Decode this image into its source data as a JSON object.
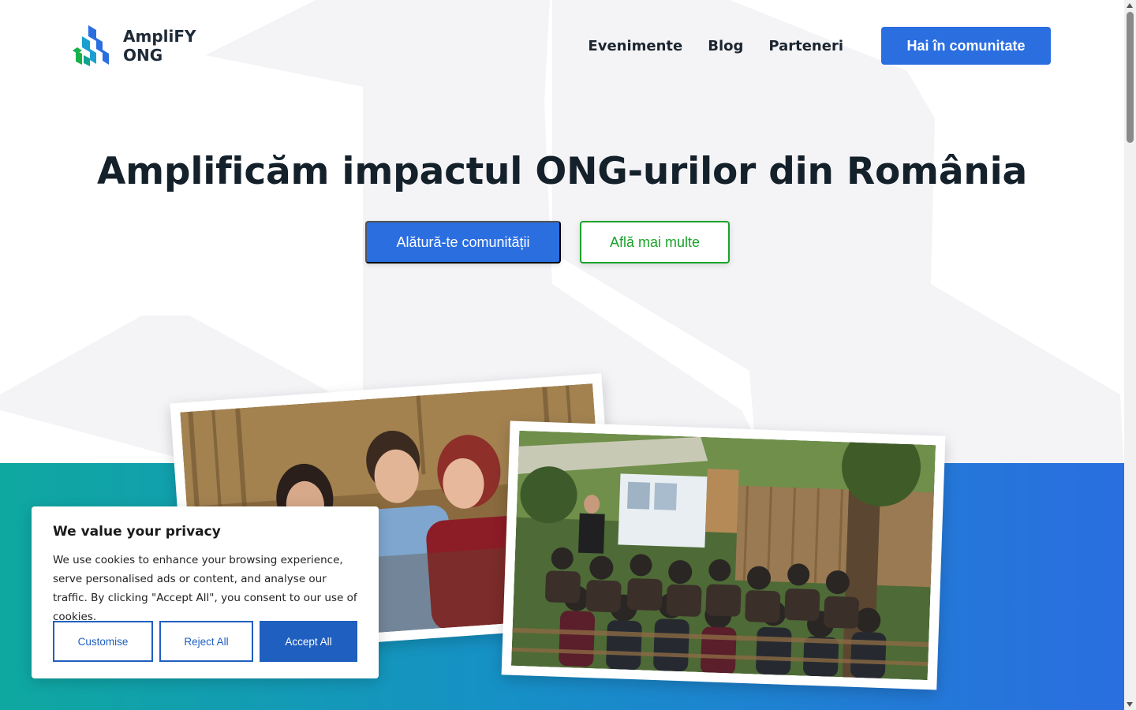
{
  "header": {
    "logo_line1": "AmpliFY",
    "logo_line2": "ONG",
    "nav": [
      {
        "label": "Evenimente"
      },
      {
        "label": "Blog"
      },
      {
        "label": "Parteneri"
      }
    ],
    "cta_label": "Hai în comunitate"
  },
  "hero": {
    "title": "Amplificăm impactul ONG-urilor din România",
    "primary_label": "Alătură-te comunității",
    "secondary_label": "Află mai multe"
  },
  "cookie_banner": {
    "title": "We value your privacy",
    "text": "We use cookies to enhance your browsing experience, serve personalised ads or content, and analyse our traffic. By clicking \"Accept All\", you consent to our use of cookies.",
    "customise_label": "Customise",
    "reject_label": "Reject All",
    "accept_label": "Accept All"
  },
  "colors": {
    "primary_blue": "#2a6ee0",
    "accent_green": "#1aa32a",
    "band_start": "#0fa8a0",
    "band_end": "#2a6ee0",
    "cookie_blue": "#1f5fbf"
  },
  "icons": {
    "logo": "amplify-logo-icon",
    "scroll_up": "chevron-up-icon",
    "scroll_down": "chevron-down-icon"
  }
}
